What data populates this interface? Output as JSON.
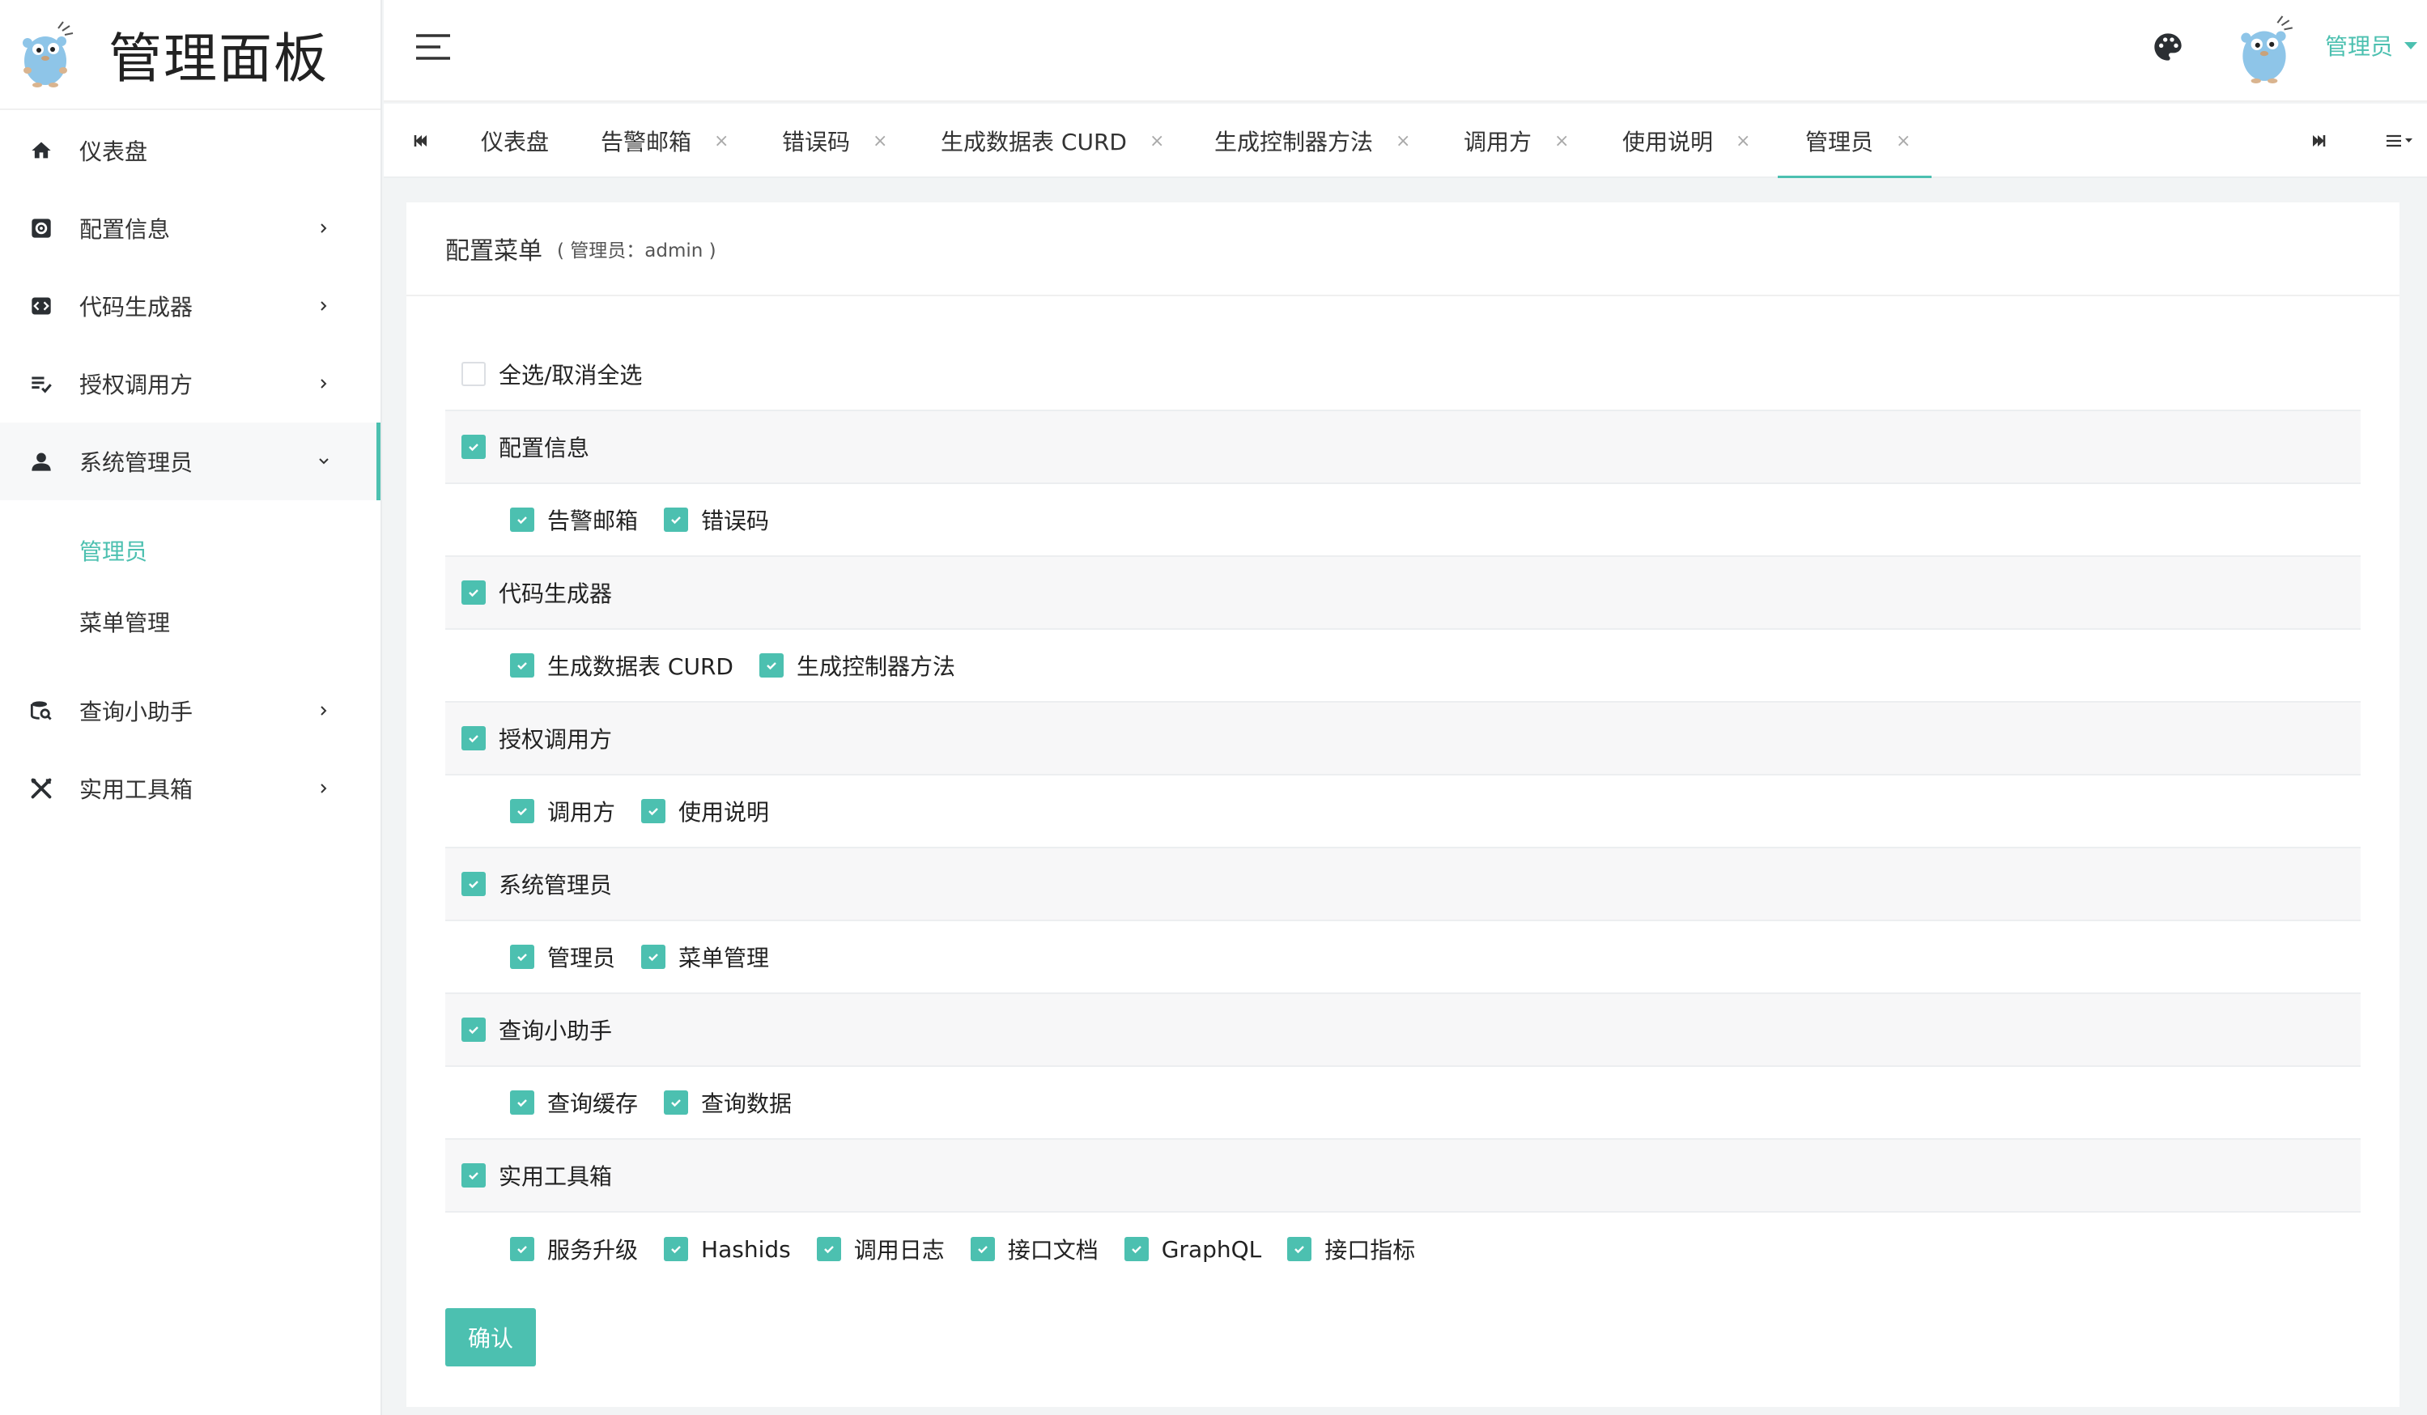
{
  "brand": {
    "title": "管理面板"
  },
  "sidebar": {
    "items": [
      {
        "label": "仪表盘",
        "icon": "home-icon"
      },
      {
        "label": "配置信息",
        "icon": "gear-icon"
      },
      {
        "label": "代码生成器",
        "icon": "code-icon"
      },
      {
        "label": "授权调用方",
        "icon": "list-check-icon"
      },
      {
        "label": "系统管理员",
        "icon": "user-icon",
        "children": [
          "管理员",
          "菜单管理"
        ]
      },
      {
        "label": "查询小助手",
        "icon": "db-search-icon"
      },
      {
        "label": "实用工具箱",
        "icon": "tools-icon"
      }
    ]
  },
  "header": {
    "username": "管理员",
    "accent": "#4cc0b0"
  },
  "tabs": [
    {
      "label": "仪表盘",
      "closable": false
    },
    {
      "label": "告警邮箱",
      "closable": true
    },
    {
      "label": "错误码",
      "closable": true
    },
    {
      "label": "生成数据表 CURD",
      "closable": true
    },
    {
      "label": "生成控制器方法",
      "closable": true
    },
    {
      "label": "调用方",
      "closable": true
    },
    {
      "label": "使用说明",
      "closable": true
    },
    {
      "label": "管理员",
      "closable": true,
      "active": true
    }
  ],
  "tab_close_glyph": "×",
  "card": {
    "title": "配置菜单",
    "subtitle": "( 管理员：admin )",
    "select_all": "全选/取消全选",
    "groups": [
      {
        "label": "配置信息",
        "children": [
          "告警邮箱",
          "错误码"
        ]
      },
      {
        "label": "代码生成器",
        "children": [
          "生成数据表 CURD",
          "生成控制器方法"
        ]
      },
      {
        "label": "授权调用方",
        "children": [
          "调用方",
          "使用说明"
        ]
      },
      {
        "label": "系统管理员",
        "children": [
          "管理员",
          "菜单管理"
        ]
      },
      {
        "label": "查询小助手",
        "children": [
          "查询缓存",
          "查询数据"
        ]
      },
      {
        "label": "实用工具箱",
        "children": [
          "服务升级",
          "Hashids",
          "调用日志",
          "接口文档",
          "GraphQL",
          "接口指标"
        ]
      }
    ],
    "confirm_label": "确认"
  }
}
